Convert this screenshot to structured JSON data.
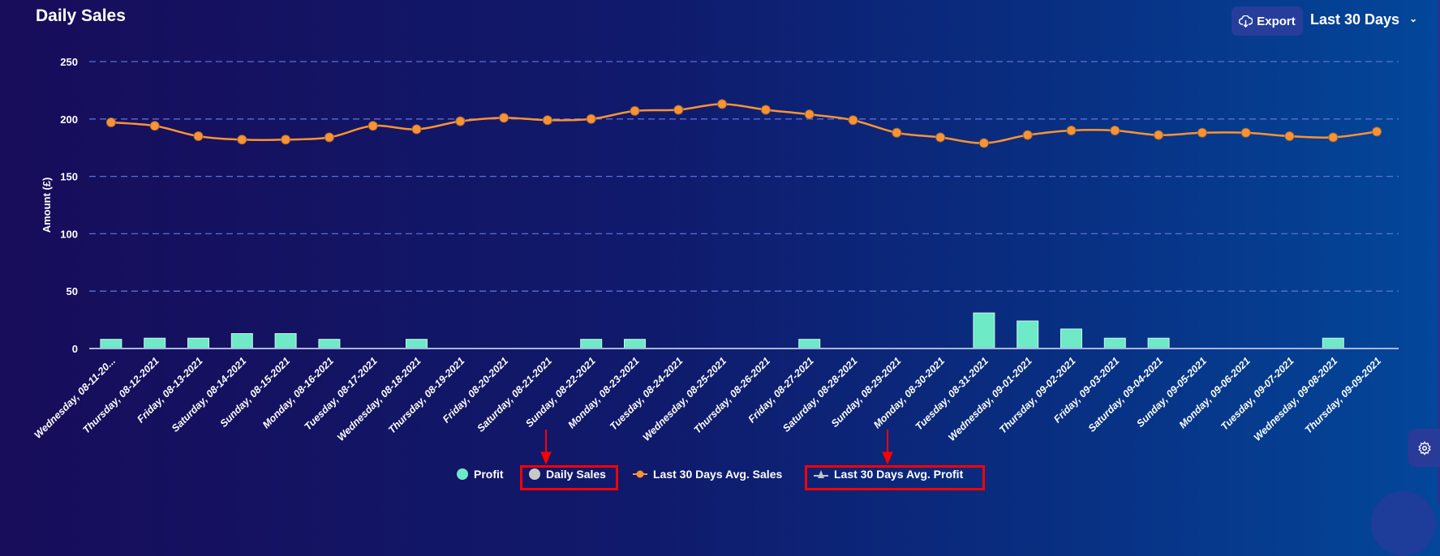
{
  "header": {
    "title": "Daily Sales",
    "export_label": "Export",
    "export_icon": "cloud-download-icon",
    "range_label": "Last 30 Days",
    "range_icon": "chevron-down-icon"
  },
  "settings_icon": "gear-icon",
  "colors": {
    "profit": "#6eeac6",
    "daily_sales": "#c8c8c8",
    "avg_sales": "#fb9332",
    "avg_profit": "#c0c4cc",
    "grid": "#5b6fd4",
    "highlight": "#ff0000"
  },
  "chart_data": {
    "type": "bar+line",
    "title": "Daily Sales",
    "ylabel": "Amount (£)",
    "ylim": [
      0,
      250
    ],
    "yticks": [
      "0",
      "50",
      "100",
      "150",
      "200",
      "250"
    ],
    "grid": true,
    "legend_placement": "bottom",
    "categories": [
      "Wednesday, 08-11-20...",
      "Thursday, 08-12-2021",
      "Friday, 08-13-2021",
      "Saturday, 08-14-2021",
      "Sunday, 08-15-2021",
      "Monday, 08-16-2021",
      "Tuesday, 08-17-2021",
      "Wednesday, 08-18-2021",
      "Thursday, 08-19-2021",
      "Friday, 08-20-2021",
      "Saturday, 08-21-2021",
      "Sunday, 08-22-2021",
      "Monday, 08-23-2021",
      "Tuesday, 08-24-2021",
      "Wednesday, 08-25-2021",
      "Thursday, 08-26-2021",
      "Friday, 08-27-2021",
      "Saturday, 08-28-2021",
      "Sunday, 08-29-2021",
      "Monday, 08-30-2021",
      "Tuesday, 08-31-2021",
      "Wednesday, 09-01-2021",
      "Thursday, 09-02-2021",
      "Friday, 09-03-2021",
      "Saturday, 09-04-2021",
      "Sunday, 09-05-2021",
      "Monday, 09-06-2021",
      "Tuesday, 09-07-2021",
      "Wednesday, 09-08-2021",
      "Thursday, 09-09-2021"
    ],
    "series": [
      {
        "name": "Profit",
        "kind": "bar",
        "values": [
          8,
          9,
          9,
          13,
          13,
          8,
          0,
          8,
          0,
          0,
          0,
          8,
          8,
          0,
          0,
          0,
          8,
          0,
          0,
          0,
          31,
          24,
          17,
          9,
          9,
          0,
          0,
          0,
          9,
          0
        ]
      },
      {
        "name": "Daily Sales",
        "kind": "bar",
        "hidden": true,
        "values": []
      },
      {
        "name": "Last 30 Days Avg. Sales",
        "kind": "line",
        "values": [
          197,
          194,
          185,
          182,
          182,
          184,
          194,
          191,
          198,
          201,
          199,
          200,
          207,
          208,
          213,
          208,
          204,
          199,
          188,
          184,
          179,
          186,
          190,
          190,
          186,
          188,
          188,
          185,
          184,
          189
        ]
      },
      {
        "name": "Last 30 Days Avg. Profit",
        "kind": "line",
        "hidden": true,
        "values": []
      }
    ]
  }
}
